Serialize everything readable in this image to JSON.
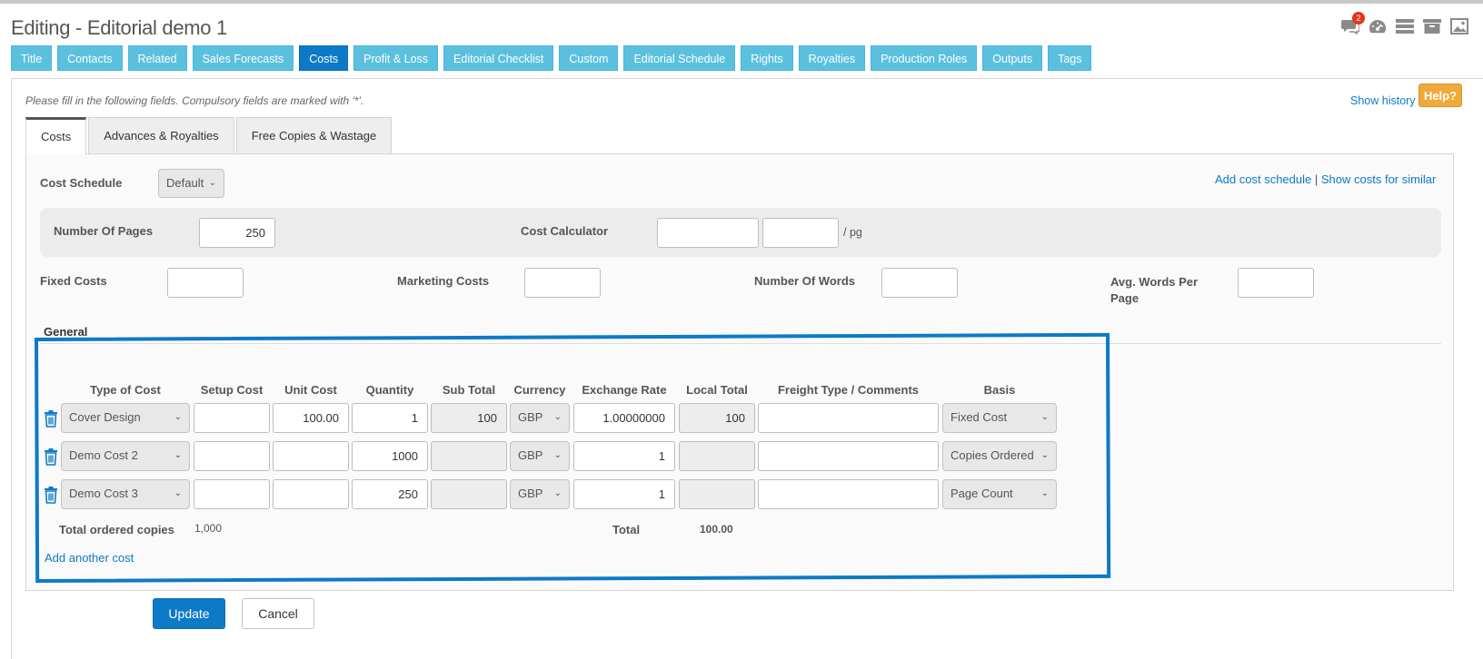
{
  "page": {
    "title": "Editing - Editorial demo 1",
    "notification_count": "2"
  },
  "top_icons": [
    "comments-icon",
    "dashboard-icon",
    "list-icon",
    "archive-icon",
    "image-icon"
  ],
  "nav": {
    "tabs": [
      "Title",
      "Contacts",
      "Related",
      "Sales Forecasts",
      "Costs",
      "Profit & Loss",
      "Editorial Checklist",
      "Custom",
      "Editorial Schedule",
      "Rights",
      "Royalties",
      "Production Roles",
      "Outputs",
      "Tags"
    ],
    "active": "Costs"
  },
  "form": {
    "hint": "Please fill in the following fields. Compulsory fields are marked with '*'.",
    "show_history": "Show history",
    "help": "Help?"
  },
  "subtabs": [
    "Costs",
    "Advances & Royalties",
    "Free Copies & Wastage"
  ],
  "cost_schedule": {
    "label": "Cost Schedule",
    "value": "Default",
    "add_link": "Add cost schedule",
    "separator": "|",
    "similar_link": "Show costs for similar"
  },
  "fields": {
    "pages_label": "Number Of Pages",
    "pages_value": "250",
    "calculator_label": "Cost Calculator",
    "per_page_suffix": "/ pg",
    "fixed_label": "Fixed Costs",
    "marketing_label": "Marketing Costs",
    "words_label": "Number Of Words",
    "avg_words_label_line1": "Avg. Words Per",
    "avg_words_label_line2": "Page"
  },
  "general": {
    "heading": "General",
    "columns": [
      "Type of Cost",
      "Setup Cost",
      "Unit Cost",
      "Quantity",
      "Sub Total",
      "Currency",
      "Exchange Rate",
      "Local Total",
      "Freight Type / Comments",
      "Basis"
    ],
    "rows": [
      {
        "type": "Cover Design",
        "setup": "",
        "unit": "100.00",
        "quantity": "1",
        "subtotal": "100",
        "currency": "GBP",
        "rate": "1.00000000",
        "local_total": "100",
        "comments": "",
        "basis": "Fixed Cost"
      },
      {
        "type": "Demo Cost 2",
        "setup": "",
        "unit": "",
        "quantity": "1000",
        "subtotal": "",
        "currency": "GBP",
        "rate": "1",
        "local_total": "",
        "comments": "",
        "basis": "Copies Ordered"
      },
      {
        "type": "Demo Cost 3",
        "setup": "",
        "unit": "",
        "quantity": "250",
        "subtotal": "",
        "currency": "GBP",
        "rate": "1",
        "local_total": "",
        "comments": "",
        "basis": "Page Count"
      }
    ],
    "total_copies_label": "Total ordered copies",
    "total_copies_value": "1,000",
    "total_label": "Total",
    "total_value": "100.00",
    "add_link": "Add another cost"
  },
  "actions": {
    "update": "Update",
    "cancel": "Cancel"
  },
  "colors": {
    "nav": "#5bc0de",
    "nav_active": "#0d7ac7",
    "highlight": "#0d7ac7",
    "help": "#f0a93b",
    "badge": "#e3361b"
  }
}
